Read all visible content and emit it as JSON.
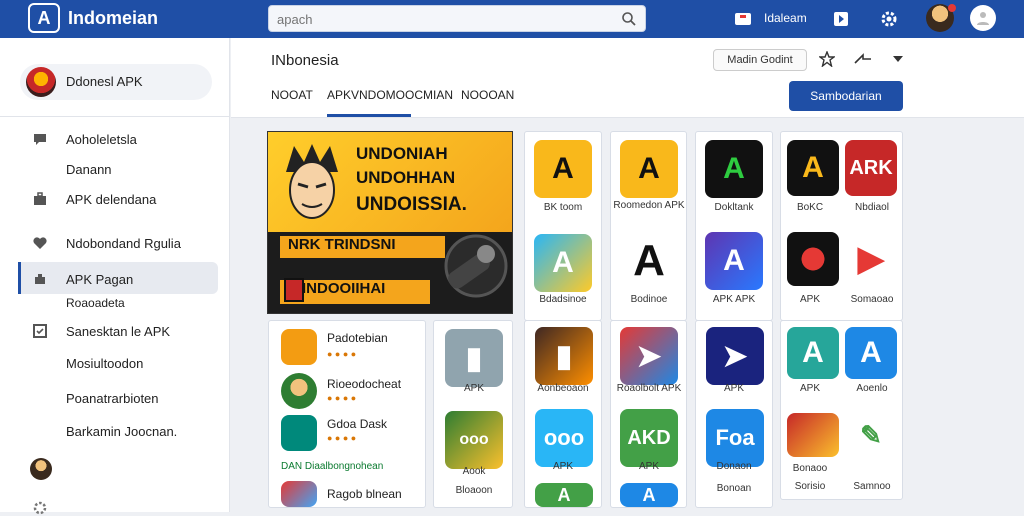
{
  "app": {
    "title": "Indomeian"
  },
  "search": {
    "placeholder": "apach"
  },
  "topbar": {
    "user_label": "Idaleam"
  },
  "sidebar": {
    "profile": "Ddonesl APK",
    "items": [
      {
        "label": "Aoholeletsla"
      },
      {
        "label": "Danann"
      },
      {
        "label": "APK delendana"
      },
      {
        "label": "Ndobondand Rgulia"
      },
      {
        "label": "APK Pagan"
      },
      {
        "label": "Roaoadeta"
      },
      {
        "label": "Sanesktan le APK"
      },
      {
        "label": "Mosiultoodon"
      },
      {
        "label": "Poanatrarbioten"
      },
      {
        "label": "Barkamin Joocnan."
      }
    ]
  },
  "header": {
    "title": "INbonesia",
    "tabs": [
      "NOOAT",
      "APKVNDOMOOCMIAN",
      "NOOOAN"
    ],
    "sort_label": "Madin Godint",
    "primary_label": "Sambodarian"
  },
  "banner": {
    "line1": "UNDONIAH",
    "line2": "UNDOHHAN",
    "line3": "UNDOISSIA.",
    "strip1": "NRK TRINDSNI",
    "strip2": "INDOOIIHAI"
  },
  "apps": {
    "a1": "BK toom",
    "a2": "Roomedon APK",
    "a3": "Dokltank",
    "a4": "BoKC",
    "a5": "Nbdiaol",
    "a6": "Bdadsinoe",
    "a7": "Bodinoe",
    "a8": "APK APK",
    "a9": "APK",
    "a10": "Somaoao",
    "b1": "APK",
    "b2": "Bloaoon",
    "b3": "Aonbeoaon",
    "b4": "Roaolbolt APK",
    "b5": "APK",
    "b6": "APK",
    "b7": "Bonaoo",
    "c1": "Aook",
    "c2": "Aoenlo",
    "c3": "APK",
    "c4": "APK",
    "c5": "Donaon",
    "c6": "Bonoan",
    "c7": "Sorisio",
    "c8": "Samnoo"
  },
  "list": [
    {
      "name": "Padotebian"
    },
    {
      "name": "Rioeodocheat"
    },
    {
      "name": "Gdoa Dask"
    },
    {
      "name": "Ragob blnean"
    }
  ],
  "list_green": "DAN Diaalbongnohean",
  "colors": {
    "brand": "#1f4fa6"
  }
}
